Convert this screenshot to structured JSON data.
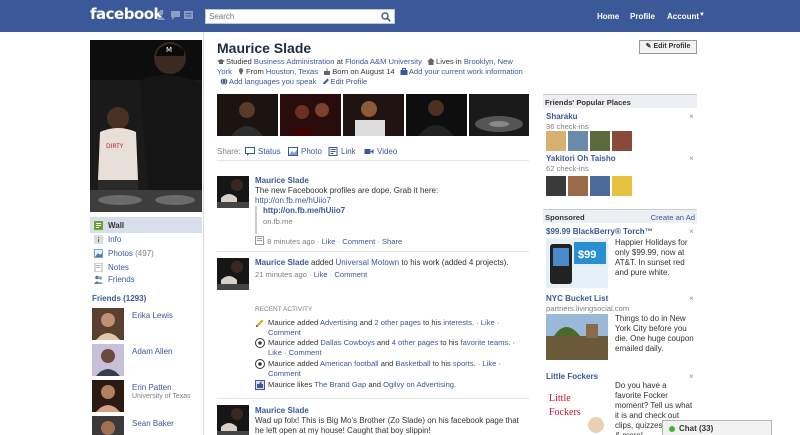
{
  "topbar": {
    "logo": "facebook",
    "search_placeholder": "Search",
    "nav": {
      "home": "Home",
      "profile": "Profile",
      "account": "Account"
    }
  },
  "sidebar": {
    "items": [
      {
        "label": "Wall",
        "count": ""
      },
      {
        "label": "Info",
        "count": ""
      },
      {
        "label": "Photos",
        "count": "(497)"
      },
      {
        "label": "Notes",
        "count": ""
      },
      {
        "label": "Friends",
        "count": ""
      }
    ],
    "friends_header": "Friends (1293)",
    "friends": [
      {
        "name": "Erika Lewis",
        "sub": ""
      },
      {
        "name": "Adam Allen",
        "sub": ""
      },
      {
        "name": "Erin Patten",
        "sub": "University of Texas"
      },
      {
        "name": "Sean Baker",
        "sub": ""
      }
    ]
  },
  "profile": {
    "name": "Maurice Slade",
    "edit_button": "Edit Profile",
    "info": {
      "studied_prefix": "Studied ",
      "studied_subject": "Business Administration",
      "at": " at ",
      "school": "Florida A&M University",
      "lives_prefix": "Lives in ",
      "lives_city": "Brooklyn, New York",
      "from_prefix": "From ",
      "from_city": "Houston, Texas",
      "born": "Born on August 14",
      "add_work": "Add your current work information",
      "add_languages": "Add languages you speak",
      "edit_profile": "Edit Profile"
    }
  },
  "share": {
    "label": "Share:",
    "status": "Status",
    "photo": "Photo",
    "link": "Link",
    "video": "Video"
  },
  "posts": [
    {
      "author": "Maurice Slade",
      "text": "The new Faceboook profiles are dope. Grab it here:",
      "link": "http://on.fb.me/hUiio7",
      "attach_title": "http://on.fb.me/hUiio7",
      "attach_domain": "on.fb.me",
      "time": "8 minutes ago",
      "actions": [
        "Like",
        "Comment",
        "Share"
      ]
    },
    {
      "author": "Maurice Slade",
      "text_pre": " added ",
      "text_link": "Universal Motown",
      "text_post": " to his work (added 4 projects).",
      "time": "21 minutes ago",
      "actions": [
        "Like",
        "Comment"
      ]
    },
    {
      "author": "Maurice Slade",
      "text": "Wad up folx! This is Big Mo's Brother (Zo Slade) on his facebook page that he left open at my house! Caught that boy slippin!"
    }
  ],
  "recent": {
    "header": "RECENT ACTIVITY",
    "items": [
      {
        "who": "Maurice added ",
        "a": "Advertising",
        "mid": " and ",
        "b": "2 other pages",
        "end": " to his ",
        "c": "interests",
        "tail": ". · ",
        "acts": [
          "Like",
          "Comment"
        ]
      },
      {
        "who": "Maurice added ",
        "a": "Dallas Cowboys",
        "mid": " and ",
        "b": "4 other pages",
        "end": " to his ",
        "c": "favorite teams",
        "tail": ". · ",
        "acts": [
          "Like",
          "Comment"
        ]
      },
      {
        "who": "Maurice added ",
        "a": "American football",
        "mid": " and ",
        "b": "Basketball",
        "end": " to his ",
        "c": "sports",
        "tail": ". · ",
        "acts": [
          "Like",
          "Comment"
        ]
      },
      {
        "who": "Maurice likes ",
        "a": "The Brand Gap",
        "mid": " and ",
        "b": "Ogilvy on Advertising",
        "end": ".",
        "c": "",
        "tail": "",
        "acts": []
      }
    ]
  },
  "right": {
    "places_header": "Friends' Popular Places",
    "places": [
      {
        "name": "Sharaku",
        "checkins": "36 check-ins"
      },
      {
        "name": "Yakitori Oh Taisho",
        "checkins": "62 check-ins"
      }
    ],
    "sponsored_header": "Sponsored",
    "create_ad": "Create an Ad",
    "ads": [
      {
        "title": "$99.99 BlackBerry® Torch™",
        "sub": "",
        "body": "Happier Holidays for only $99.99, now at AT&T. In sunset red and pure white.",
        "img_text": "$99"
      },
      {
        "title": "NYC Bucket List",
        "sub": "partners.livingsocial.com",
        "body": "Things to do in New York City before you die. One huge coupon emailed daily.",
        "img_text": ""
      },
      {
        "title": "Little Fockers",
        "sub": "",
        "body": "Do you have a favorite Focker moment? Tell us what it is and check out clips, quizzes, quotes & more!",
        "img_text": "Little Fockers"
      }
    ],
    "close_glyph": "×"
  },
  "chat": {
    "label": "Chat (33)"
  },
  "colors": {
    "brand": "#3b5998",
    "wall_bg": "#d8dfea",
    "header_bg": "#edeff4"
  }
}
